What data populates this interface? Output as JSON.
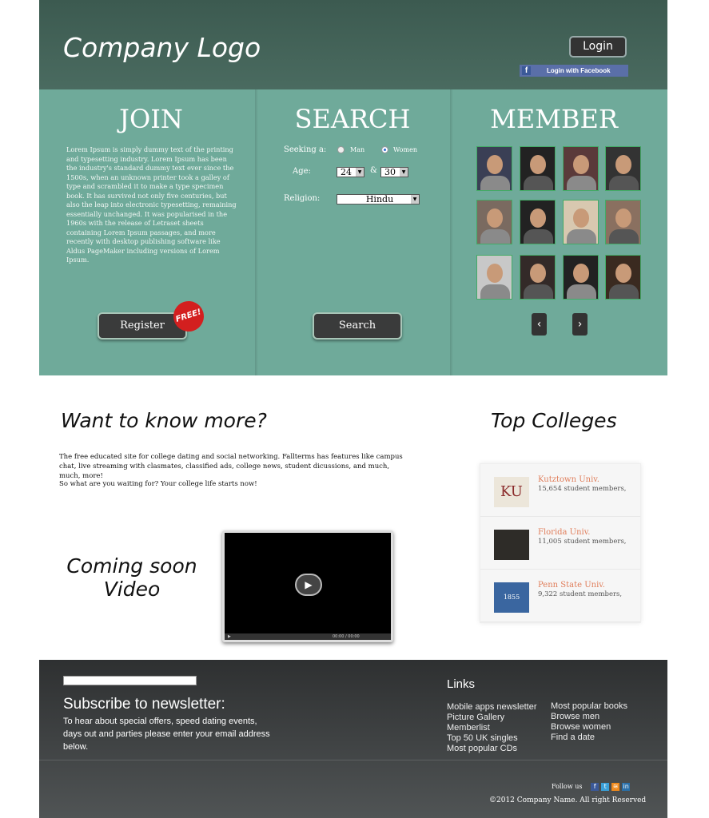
{
  "header": {
    "logo": "Company Logo",
    "login": "Login",
    "facebook_login": "Login with Facebook"
  },
  "join": {
    "title": "JOIN",
    "text": "Lorem Ipsum is simply dummy text of the printing and typesetting industry. Lorem Ipsum has been the industry's standard dummy text ever since the 1500s, when an unknown printer took a galley of type and scrambled it to make a type specimen book. It has survived not only five centuries, but also the leap into electronic typesetting, remaining essentially unchanged. It was popularised in the 1960s with the release of Letraset sheets containing Lorem Ipsum passages, and more recently with desktop publishing software like Aldus PageMaker including versions of Lorem Ipsum.",
    "register": "Register",
    "badge": "FREE!"
  },
  "search": {
    "title": "SEARCH",
    "seeking_label": "Seeking a:",
    "man": "Man",
    "women": "Women",
    "selected": "Women",
    "age_label": "Age:",
    "age_from": "24",
    "and": "&",
    "age_to": "30",
    "religion_label": "Religion:",
    "religion": "Hindu",
    "button": "Search"
  },
  "member": {
    "title": "MEMBER",
    "photo_colors": [
      "#3a3f55",
      "#222",
      "#5a3a3a",
      "#333",
      "#7a6a60",
      "#222",
      "#d8c8b0",
      "#8a7060",
      "#c8c8c8",
      "#332a28",
      "#222",
      "#3a2a20"
    ],
    "prev": "‹",
    "next": "›"
  },
  "info": {
    "heading": "Want to know more?",
    "p1": "The free educated site for college dating and social networking. Fallterms has features like campus chat, live streaming with clasmates, classified ads, college news, student dicussions, and much, much, more!",
    "p2": "So what are you waiting for? Your college life starts now!",
    "video_label_1": "Coming soon",
    "video_label_2": "Video",
    "video_time": "00:00 / 00:00"
  },
  "colleges": {
    "heading": "Top Colleges",
    "items": [
      {
        "name": "Kutztown Univ.",
        "members": "15,654 student members,",
        "logo": "KU",
        "color": "#ece6da"
      },
      {
        "name": "Florida Univ.",
        "members": "11,005 student members,",
        "logo": "",
        "color": "#2e2c28"
      },
      {
        "name": "Penn State Univ.",
        "members": "9,322 student members,",
        "logo": "1855",
        "color": "#3a66a0"
      }
    ]
  },
  "footer": {
    "newsletter_title": "Subscribe to newsletter:",
    "newsletter_text": "To hear about special offers, speed dating events, days out and parties please enter your email address below.",
    "links_title": "Links",
    "links_col1": [
      "Mobile apps newsletter",
      "Picture Gallery",
      "Memberlist",
      "Top 50 UK singles",
      "Most popular CDs"
    ],
    "links_col2": [
      "Most popular books",
      "Browse men",
      "Browse women",
      "Find a date"
    ],
    "follow": "Follow us",
    "copyright": "©2012 Company Name. All right Reserved"
  }
}
